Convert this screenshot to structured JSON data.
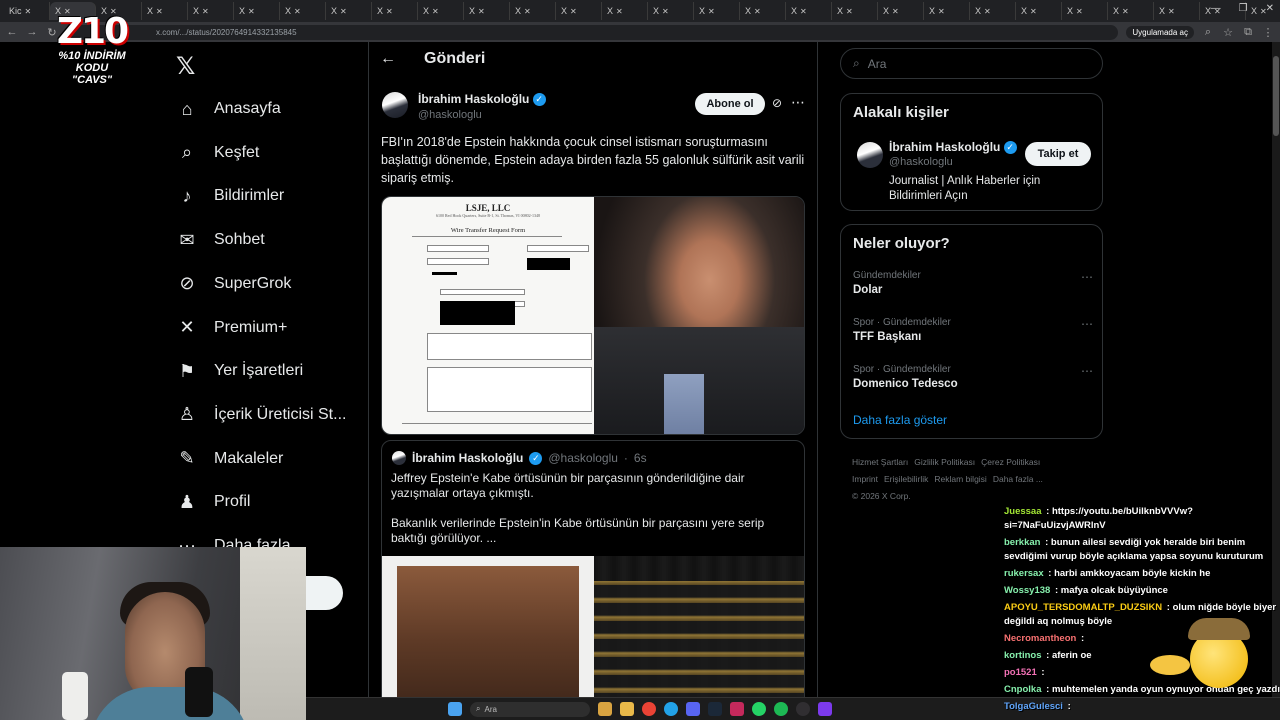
{
  "browser": {
    "tabs": [
      "Kic",
      "X",
      "X",
      "X",
      "X",
      "X",
      "X",
      "X",
      "X",
      "X",
      "X",
      "X",
      "X",
      "X",
      "X",
      "X",
      "X",
      "X",
      "X",
      "X",
      "X",
      "X",
      "X",
      "X",
      "X",
      "X",
      "X",
      "X",
      "xco",
      "X"
    ],
    "url": "x.com/.../status/2020764914332135845",
    "apps_label": "Uygulamada aç"
  },
  "overlay": {
    "logo_text": "Z10",
    "promo_line1": "%10 İNDİRİM KODU",
    "promo_line2": "\"CAVS\""
  },
  "nav": {
    "items": [
      {
        "label": "Anasayfa",
        "icon": "home-icon"
      },
      {
        "label": "Keşfet",
        "icon": "search-icon"
      },
      {
        "label": "Bildirimler",
        "icon": "bell-icon"
      },
      {
        "label": "Sohbet",
        "icon": "mail-icon"
      },
      {
        "label": "SuperGrok",
        "icon": "grok-icon"
      },
      {
        "label": "Premium+",
        "icon": "x-icon"
      },
      {
        "label": "Yer İşaretleri",
        "icon": "bookmark-icon"
      },
      {
        "label": "İçerik Üreticisi St...",
        "icon": "creator-icon"
      },
      {
        "label": "Makaleler",
        "icon": "article-icon"
      },
      {
        "label": "Profil",
        "icon": "person-icon"
      },
      {
        "label": "Daha fazla",
        "icon": "more-icon"
      }
    ]
  },
  "post": {
    "header_title": "Gönderi",
    "author_name": "İbrahim Haskoloğlu",
    "author_handle": "@haskologlu",
    "subscribe_label": "Abone ol",
    "text": "FBI'ın 2018'de Epstein hakkında çocuk cinsel istismarı soruşturmasını başlattığı dönemde, Epstein adaya birden fazla 55 galonluk sülfürik asit varili sipariş etmiş.",
    "document": {
      "company": "LSJE, LLC",
      "address": "6100 Red Hook Quarters, Suite B-1, St. Thomas, VI 00802-1348",
      "form_title": "Wire Transfer Request Form"
    },
    "quote": {
      "author_name": "İbrahim Haskoloğlu",
      "author_handle": "@haskologlu",
      "time": "6s",
      "text1": "Jeffrey Epstein'e Kabe örtüsünün bir parçasının gönderildiğine dair yazışmalar ortaya çıkmıştı.",
      "text2": "Bakanlık verilerinde Epstein'in Kabe örtüsünün bir parçasını yere serip baktığı görülüyor. ..."
    }
  },
  "right": {
    "search_placeholder": "Ara",
    "related_title": "Alakalı kişiler",
    "related_person": {
      "name": "İbrahim Haskoloğlu",
      "handle": "@haskologlu",
      "bio": "Journalist | Anlık Haberler için Bildirimleri Açın",
      "follow_label": "Takip et"
    },
    "trending_title": "Neler oluyor?",
    "trends": [
      {
        "category": "Gündemdekiler",
        "title": "Dolar"
      },
      {
        "category": "Spor · Gündemdekiler",
        "title": "TFF Başkanı"
      },
      {
        "category": "Spor · Gündemdekiler",
        "title": "Domenico Tedesco"
      }
    ],
    "show_more": "Daha fazla göster",
    "footer": [
      "Hizmet Şartları",
      "Gizlilik Politikası",
      "Çerez Politikası",
      "Imprint",
      "Erişilebilirlik",
      "Reklam bilgisi",
      "Daha fazla ...",
      "© 2026 X Corp."
    ]
  },
  "chat": [
    {
      "user": "Juessaa",
      "color": "#a3e635",
      "msg": "https://youtu.be/bUilknbVVVw?si=7NaFuUizvjAWRlnV"
    },
    {
      "user": "berkkan",
      "color": "#86efac",
      "msg": "bunun ailesi sevdiği yok heralde biri benim sevdiğimi vurup böyle açıklama yapsa soyunu kuruturum"
    },
    {
      "user": "rukersax",
      "color": "#86efac",
      "msg": "harbi amkkoyacam böyle kickin he"
    },
    {
      "user": "Wossy138",
      "color": "#86efac",
      "msg": "mafya olcak büyüyünce"
    },
    {
      "user": "APOYU_TERSDOMALTP_DUZSIKN",
      "color": "#facc15",
      "msg": "olum niğde böyle biyer değildi aq nolmuş böyle"
    },
    {
      "user": "Necromantheon",
      "color": "#f87171",
      "msg": ""
    },
    {
      "user": "kortinos",
      "color": "#86efac",
      "msg": "aferin oe"
    },
    {
      "user": "po1521",
      "color": "#f472b6",
      "msg": ""
    },
    {
      "user": "Cnpolka",
      "color": "#86efac",
      "msg": "muhtemelen yanda oyun oynuyor ondan geç yazdı"
    },
    {
      "user": "TolgaGulesci",
      "color": "#60a5fa",
      "msg": ""
    }
  ],
  "taskbar": {
    "search_label": "Ara"
  }
}
